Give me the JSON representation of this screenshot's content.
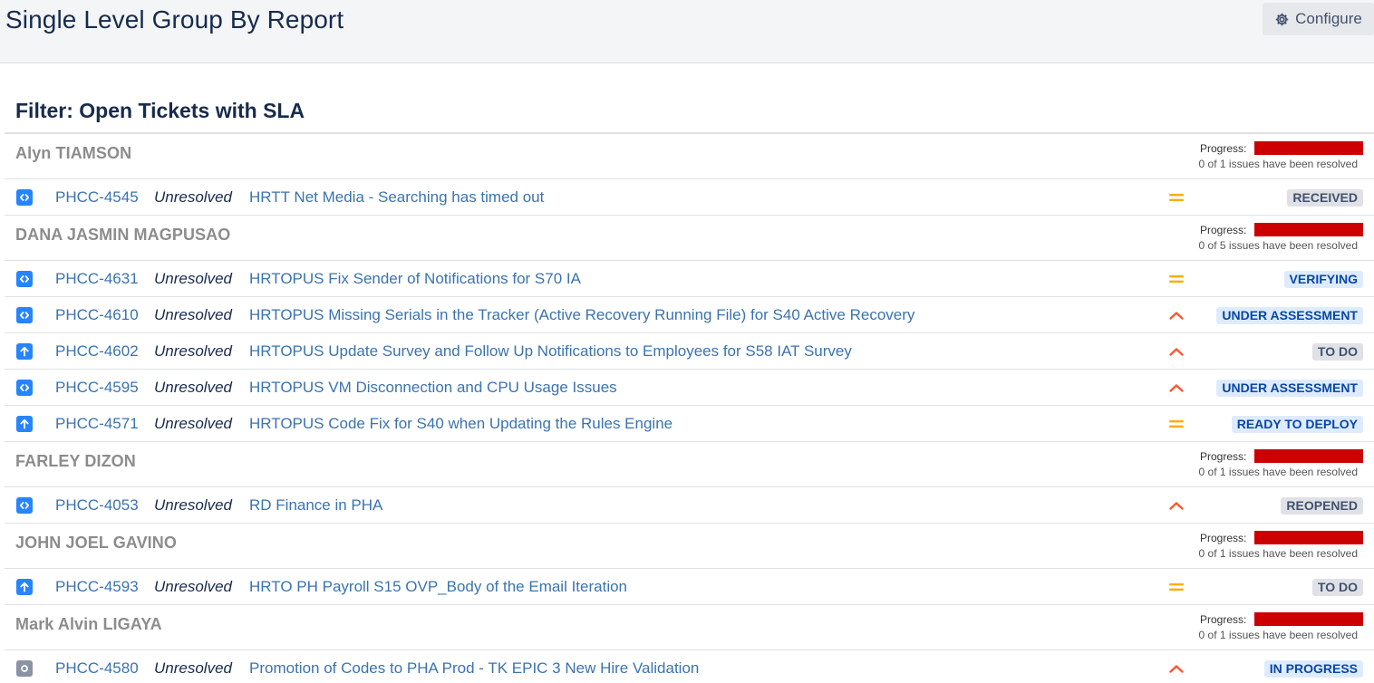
{
  "header": {
    "title": "Single Level Group By Report",
    "configure_label": "Configure"
  },
  "filter": {
    "title": "Filter: Open Tickets with SLA"
  },
  "colors": {
    "bug_type": "#2684ff",
    "improvement_type": "#2684ff",
    "task_type": "#8993a4",
    "priority_medium": "#ffab00",
    "priority_high": "#ff5630",
    "status_grey_bg": "#dfe1e6",
    "status_grey_text": "#42526e",
    "status_blue_bg": "#deebff",
    "status_blue_text": "#0747a6",
    "progress_bar": "#cc0000"
  },
  "groups": [
    {
      "name": "Alyn TIAMSON",
      "progress_label": "Progress:",
      "progress_text": "0 of 1 issues have been resolved",
      "resolved_fraction": 0,
      "issues": [
        {
          "type_icon": "code-icon",
          "key": "PHCC-4545",
          "resolution": "Unresolved",
          "summary": "HRTT Net Media - Searching has timed out",
          "priority": "medium",
          "status": "RECEIVED",
          "status_style": "grey"
        }
      ]
    },
    {
      "name": "DANA JASMIN MAGPUSAO",
      "progress_label": "Progress:",
      "progress_text": "0 of 5 issues have been resolved",
      "resolved_fraction": 0,
      "issues": [
        {
          "type_icon": "code-icon",
          "key": "PHCC-4631",
          "resolution": "Unresolved",
          "summary": "HRTOPUS Fix Sender of Notifications for S70 IA",
          "priority": "medium",
          "status": "VERIFYING",
          "status_style": "blue"
        },
        {
          "type_icon": "code-icon",
          "key": "PHCC-4610",
          "resolution": "Unresolved",
          "summary": "HRTOPUS Missing Serials in the Tracker (Active Recovery Running File) for S40 Active Recovery",
          "priority": "high",
          "status": "UNDER ASSESSMENT",
          "status_style": "blue"
        },
        {
          "type_icon": "arrow-up-icon",
          "key": "PHCC-4602",
          "resolution": "Unresolved",
          "summary": "HRTOPUS Update Survey and Follow Up Notifications to Employees for S58 IAT Survey",
          "priority": "high",
          "status": "TO DO",
          "status_style": "grey"
        },
        {
          "type_icon": "code-icon",
          "key": "PHCC-4595",
          "resolution": "Unresolved",
          "summary": "HRTOPUS VM Disconnection and CPU Usage Issues",
          "priority": "high",
          "status": "UNDER ASSESSMENT",
          "status_style": "blue"
        },
        {
          "type_icon": "arrow-up-icon",
          "key": "PHCC-4571",
          "resolution": "Unresolved",
          "summary": "HRTOPUS Code Fix for S40 when Updating the Rules Engine",
          "priority": "medium",
          "status": "READY TO DEPLOY",
          "status_style": "blue"
        }
      ]
    },
    {
      "name": "FARLEY DIZON",
      "progress_label": "Progress:",
      "progress_text": "0 of 1 issues have been resolved",
      "resolved_fraction": 0,
      "issues": [
        {
          "type_icon": "code-icon",
          "key": "PHCC-4053",
          "resolution": "Unresolved",
          "summary": "RD Finance in PHA",
          "priority": "high",
          "status": "REOPENED",
          "status_style": "grey"
        }
      ]
    },
    {
      "name": "JOHN JOEL GAVINO",
      "progress_label": "Progress:",
      "progress_text": "0 of 1 issues have been resolved",
      "resolved_fraction": 0,
      "issues": [
        {
          "type_icon": "arrow-up-icon",
          "key": "PHCC-4593",
          "resolution": "Unresolved",
          "summary": "HRTO PH Payroll S15 OVP_Body of the Email Iteration",
          "priority": "medium",
          "status": "TO DO",
          "status_style": "grey"
        }
      ]
    },
    {
      "name": "Mark Alvin LIGAYA",
      "progress_label": "Progress:",
      "progress_text": "0 of 1 issues have been resolved",
      "resolved_fraction": 0,
      "issues": [
        {
          "type_icon": "task-icon",
          "key": "PHCC-4580",
          "resolution": "Unresolved",
          "summary": "Promotion of Codes to PHA Prod - TK EPIC 3 New Hire Validation",
          "priority": "high",
          "status": "IN PROGRESS",
          "status_style": "blue"
        }
      ]
    }
  ]
}
